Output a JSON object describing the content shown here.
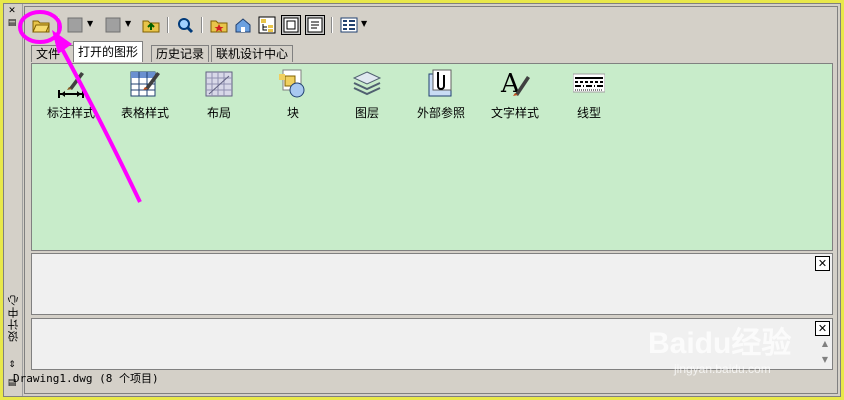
{
  "window": {
    "vertical_title": "设计中心"
  },
  "toolbar": {
    "buttons": [
      {
        "name": "load-button",
        "icon": "folder-open-icon"
      },
      {
        "name": "back-button",
        "icon": "gray-square-icon"
      },
      {
        "name": "forward-button",
        "icon": "gray-square-icon"
      },
      {
        "name": "up-button",
        "icon": "up-folder-icon"
      },
      {
        "name": "search-button",
        "icon": "search-icon"
      },
      {
        "name": "favorites-button",
        "icon": "favorites-icon"
      },
      {
        "name": "home-button",
        "icon": "home-icon"
      },
      {
        "name": "tree-toggle-button",
        "icon": "tree-icon"
      },
      {
        "name": "preview-button",
        "icon": "preview-icon"
      },
      {
        "name": "description-button",
        "icon": "description-icon"
      },
      {
        "name": "views-button",
        "icon": "views-icon"
      }
    ]
  },
  "tabs": [
    {
      "label": "文件夹",
      "visible_label": "文件"
    },
    {
      "label": "打开的图形"
    },
    {
      "label": "历史记录"
    },
    {
      "label": "联机设计中心"
    }
  ],
  "items": [
    {
      "label": "标注样式",
      "icon": "dimension-style-icon"
    },
    {
      "label": "表格样式",
      "icon": "table-style-icon"
    },
    {
      "label": "布局",
      "icon": "layout-icon"
    },
    {
      "label": "块",
      "icon": "block-icon"
    },
    {
      "label": "图层",
      "icon": "layers-icon"
    },
    {
      "label": "外部参照",
      "icon": "xref-icon"
    },
    {
      "label": "文字样式",
      "icon": "text-style-icon"
    },
    {
      "label": "线型",
      "icon": "linetype-icon"
    }
  ],
  "status": {
    "text": "Drawing1.dwg (8 个项目)"
  },
  "watermark": {
    "logo": "Baidu经验",
    "sub": "jingyan.baidu.com"
  },
  "colors": {
    "content_bg": "#c8ecca",
    "annotation": "#ff00ff",
    "outer_bg": "#e8e84a"
  }
}
